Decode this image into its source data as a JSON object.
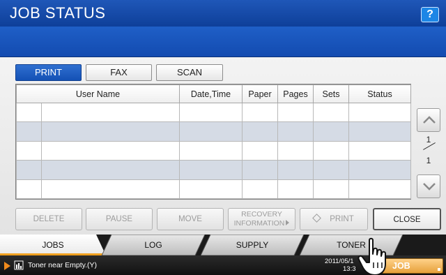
{
  "header": {
    "title": "JOB STATUS",
    "help_label": "?"
  },
  "tabs": [
    {
      "label": "PRINT",
      "active": true
    },
    {
      "label": "FAX",
      "active": false
    },
    {
      "label": "SCAN",
      "active": false
    }
  ],
  "table": {
    "columns": [
      "User Name",
      "Date,Time",
      "Paper",
      "Pages",
      "Sets",
      "Status"
    ],
    "rows": [
      [
        "",
        "",
        "",
        "",
        "",
        "",
        ""
      ],
      [
        "",
        "",
        "",
        "",
        "",
        "",
        ""
      ],
      [
        "",
        "",
        "",
        "",
        "",
        "",
        ""
      ],
      [
        "",
        "",
        "",
        "",
        "",
        "",
        ""
      ],
      [
        "",
        "",
        "",
        "",
        "",
        "",
        ""
      ]
    ]
  },
  "pager": {
    "current": "1",
    "total": "1"
  },
  "actions": {
    "delete": "DELETE",
    "pause": "PAUSE",
    "move": "MOVE",
    "recovery_line1": "RECOVERY",
    "recovery_line2": "INFORMATION",
    "print": "PRINT",
    "close": "CLOSE"
  },
  "bottom_tabs": [
    {
      "label": "JOBS",
      "active": true
    },
    {
      "label": "LOG",
      "active": false
    },
    {
      "label": "SUPPLY",
      "active": false
    },
    {
      "label": "TONER",
      "active": false
    }
  ],
  "status_bar": {
    "message": "Toner near Empty.(Y)",
    "date": "2011/05/1",
    "time": "13:3",
    "job_status_button": "JOB STATUS"
  },
  "colors": {
    "accent": "#1451b5",
    "tab_active": "#f0a020",
    "warning": "#f08a1c"
  },
  "icons": [
    "help-icon",
    "up-arrow-icon",
    "down-arrow-icon",
    "print-diamond-icon",
    "play-icon",
    "toner-icon",
    "hand-pointer-icon"
  ]
}
